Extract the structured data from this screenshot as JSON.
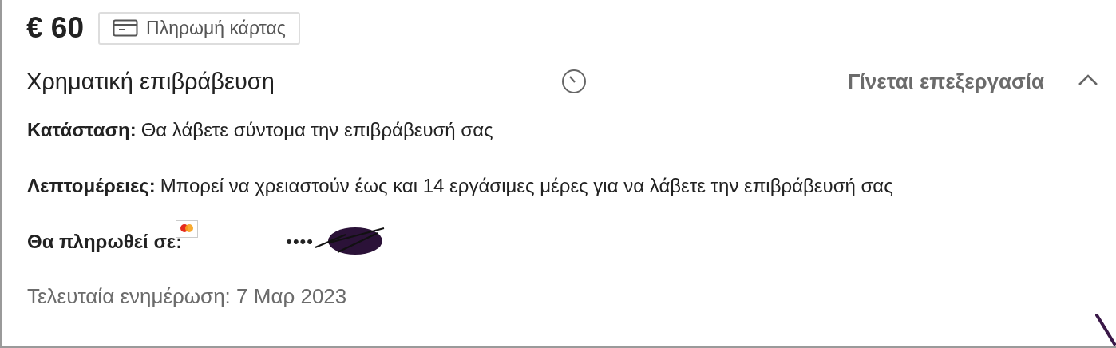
{
  "amount": "€ 60",
  "payment_badge": {
    "label": "Πληρωμή κάρτας"
  },
  "reward": {
    "title": "Χρηματική επιβράβευση",
    "status": "Γίνεται επεξεργασία",
    "expanded": true
  },
  "details": [
    {
      "kind": "text",
      "label": "Κατάσταση:",
      "value": "Θα λάβετε σύντομα την επιβράβευσή σας"
    },
    {
      "kind": "text",
      "label": "Λεπτομέρειες:",
      "value": "Μπορεί να χρειαστούν έως και 14 εργάσιμες μέρες για να λάβετε την επιβράβευσή σας"
    },
    {
      "kind": "card",
      "label": "Θα πληρωθεί σε:",
      "value": "••••"
    }
  ],
  "last_updated": "Τελευταία ενημέρωση: 7 Μαρ 2023"
}
